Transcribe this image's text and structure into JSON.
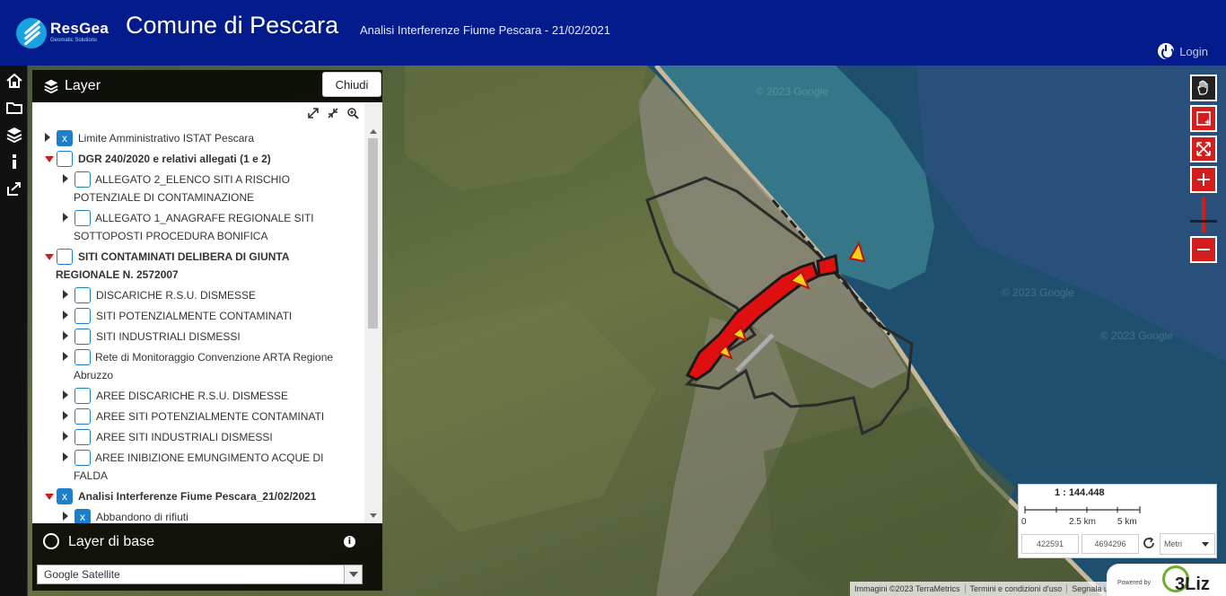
{
  "header": {
    "logo_brand": "ResGea",
    "logo_tagline": "Geomatic Solutions",
    "title": "Comune di Pescara",
    "subtitle": "Analisi Interferenze Fiume Pescara - 21/02/2021",
    "login_label": "Login"
  },
  "left_toolbar": [
    {
      "name": "home-icon"
    },
    {
      "name": "folder-icon"
    },
    {
      "name": "layers-icon"
    },
    {
      "name": "info-icon"
    },
    {
      "name": "share-icon"
    }
  ],
  "layer_panel": {
    "title": "Layer",
    "close_label": "Chiudi",
    "tree": [
      {
        "label": "Limite Amministrativo ISTAT Pescara",
        "level": 0,
        "expander": "right",
        "checked": true,
        "bold": false
      },
      {
        "label": "DGR 240/2020 e relativi allegati (1 e 2)",
        "level": 0,
        "expander": "down",
        "checked": false,
        "bold": true
      },
      {
        "label": "ALLEGATO 2_ELENCO SITI A RISCHIO POTENZIALE DI CONTAMINAZIONE",
        "level": 1,
        "expander": "right",
        "checked": false,
        "bold": false
      },
      {
        "label": "ALLEGATO 1_ANAGRAFE REGIONALE SITI SOTTOPOSTI PROCEDURA BONIFICA",
        "level": 1,
        "expander": "right",
        "checked": false,
        "bold": false
      },
      {
        "label": "SITI CONTAMINATI DELIBERA DI GIUNTA REGIONALE N. 2572007",
        "level": 0,
        "expander": "down",
        "checked": false,
        "bold": true
      },
      {
        "label": "DISCARICHE R.S.U. DISMESSE",
        "level": 1,
        "expander": "right",
        "checked": false,
        "bold": false
      },
      {
        "label": "SITI POTENZIALMENTE CONTAMINATI",
        "level": 1,
        "expander": "right",
        "checked": false,
        "bold": false
      },
      {
        "label": "SITI INDUSTRIALI DISMESSI",
        "level": 1,
        "expander": "right",
        "checked": false,
        "bold": false
      },
      {
        "label": "Rete di Monitoraggio Convenzione ARTA Regione Abruzzo",
        "level": 1,
        "expander": "right",
        "checked": false,
        "bold": false
      },
      {
        "label": "AREE DISCARICHE R.S.U. DISMESSE",
        "level": 1,
        "expander": "right",
        "checked": false,
        "bold": false
      },
      {
        "label": "AREE SITI POTENZIALMENTE CONTAMINATI",
        "level": 1,
        "expander": "right",
        "checked": false,
        "bold": false
      },
      {
        "label": "AREE SITI INDUSTRIALI DISMESSI",
        "level": 1,
        "expander": "right",
        "checked": false,
        "bold": false
      },
      {
        "label": "AREE INIBIZIONE EMUNGIMENTO ACQUE DI FALDA",
        "level": 1,
        "expander": "right",
        "checked": false,
        "bold": false
      },
      {
        "label": "Analisi Interferenze Fiume Pescara_21/02/2021",
        "level": 0,
        "expander": "down",
        "checked": true,
        "bold": true
      },
      {
        "label": "Abbandono di rifiuti",
        "level": 1,
        "expander": "right",
        "checked": true,
        "bold": false
      }
    ],
    "base_title": "Layer di base",
    "base_selected": "Google Satellite"
  },
  "map": {
    "watermarks": [
      "© 2023 Google",
      "© 2023 Google",
      "© 2023 Google"
    ],
    "scale_text": "1 : 144.448",
    "scale_labels": [
      "0",
      "2.5 km",
      "5 km"
    ],
    "coord_x": "422591",
    "coord_y": "4694296",
    "unit": "Metri",
    "attribution": [
      "Immagini ©2023 TerraMetrics",
      "Termini e condizioni d'uso",
      "Segnala un errore"
    ],
    "powered_by": "Powered by",
    "powered_brand": "3Liz"
  },
  "colors": {
    "header_bg": "#041b8c",
    "accent_blue": "#1d7fc9",
    "map_tool_red": "#d31e1e"
  }
}
